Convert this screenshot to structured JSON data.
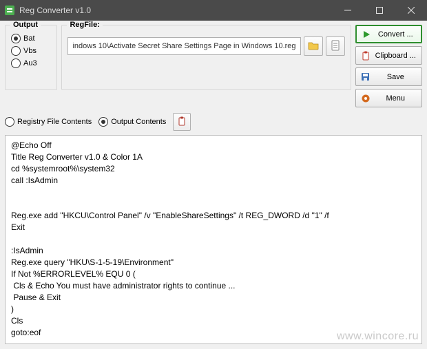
{
  "window": {
    "title": "Reg Converter v1.0"
  },
  "output_group": {
    "label": "Output",
    "options": [
      "Bat",
      "Vbs",
      "Au3"
    ],
    "selected": 0
  },
  "regfile_group": {
    "label": "RegFile:",
    "path": "indows 10\\Activate Secret Share Settings Page in Windows 10.reg"
  },
  "side_buttons": {
    "convert": "Convert ...",
    "clipboard": "Clipboard ...",
    "save": "Save",
    "menu": "Menu"
  },
  "mode": {
    "registry": "Registry File Contents",
    "output": "Output Contents",
    "selected": "output"
  },
  "output_text": "@Echo Off\nTitle Reg Converter v1.0 & Color 1A\ncd %systemroot%\\system32\ncall :IsAdmin\n\n\nReg.exe add \"HKCU\\Control Panel\" /v \"EnableShareSettings\" /t REG_DWORD /d \"1\" /f\nExit\n\n:IsAdmin\nReg.exe query \"HKU\\S-1-5-19\\Environment\"\nIf Not %ERRORLEVEL% EQU 0 (\n Cls & Echo You must have administrator rights to continue ...\n Pause & Exit\n)\nCls\ngoto:eof",
  "watermark": "www.wincore.ru"
}
